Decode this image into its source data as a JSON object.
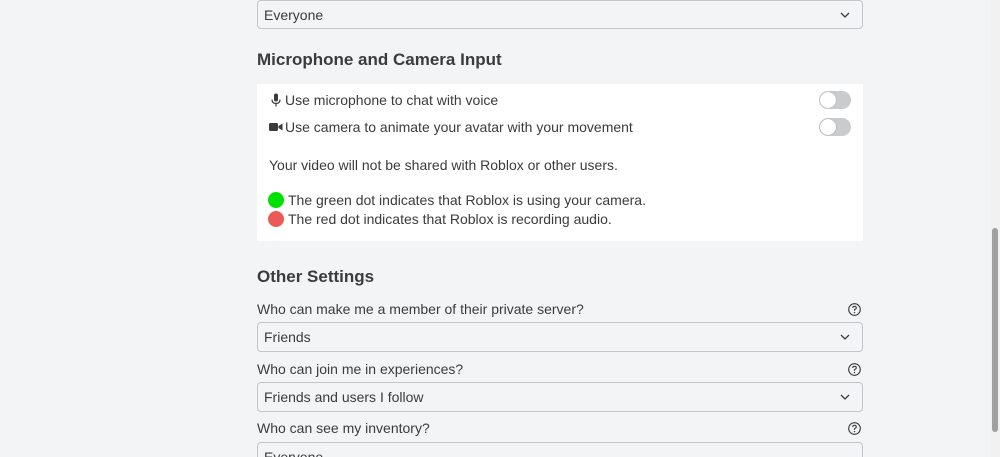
{
  "top_select": {
    "value": "Everyone"
  },
  "mic_camera": {
    "title": "Microphone and Camera Input",
    "mic_label": "Use microphone to chat with voice",
    "mic_icon": "microphone-icon",
    "mic_enabled": false,
    "camera_label": "Use camera to animate your avatar with your movement",
    "camera_icon": "video-camera-icon",
    "camera_enabled": false,
    "privacy_note": "Your video will not be shared with Roblox or other users.",
    "green_dot_text": "The green dot indicates that Roblox is using your camera.",
    "red_dot_text": "The red dot indicates that Roblox is recording audio.",
    "green_color": "#00e000",
    "red_color": "#ec5a55"
  },
  "other_settings": {
    "title": "Other Settings",
    "items": [
      {
        "question": "Who can make me a member of their private server?",
        "value": "Friends"
      },
      {
        "question": "Who can join me in experiences?",
        "value": "Friends and users I follow"
      },
      {
        "question": "Who can see my inventory?",
        "value": "Everyone"
      }
    ]
  },
  "icons": {
    "chevron": "chevron-down-icon",
    "help": "question-circle-icon"
  }
}
